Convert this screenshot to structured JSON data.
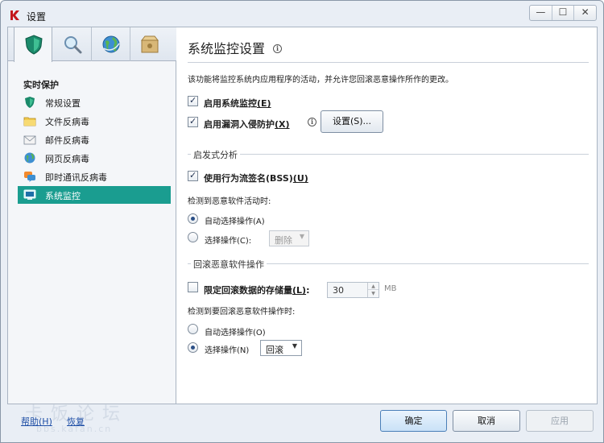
{
  "window": {
    "title": "设置",
    "accent_color": "#1a9d90"
  },
  "titlebar": {
    "minimize_glyph": "—",
    "maximize_glyph": "☐",
    "close_glyph": "✕"
  },
  "tabs": [
    {
      "name": "protection",
      "icon": "shield-icon",
      "active": true
    },
    {
      "name": "scan",
      "icon": "magnifier-icon",
      "active": false
    },
    {
      "name": "update",
      "icon": "globe-icon",
      "active": false
    },
    {
      "name": "options",
      "icon": "box-icon",
      "active": false
    }
  ],
  "sidebar": {
    "section_title": "实时保护",
    "items": [
      {
        "label": "常规设置",
        "icon": "shield-icon"
      },
      {
        "label": "文件反病毒",
        "icon": "folder-icon"
      },
      {
        "label": "邮件反病毒",
        "icon": "mail-icon"
      },
      {
        "label": "网页反病毒",
        "icon": "globe-icon"
      },
      {
        "label": "即时通讯反病毒",
        "icon": "chat-icon"
      },
      {
        "label": "系统监控",
        "icon": "monitor-icon",
        "selected": true
      }
    ]
  },
  "main": {
    "title": "系统监控设置",
    "description": "该功能将监控系统内应用程序的活动，并允许您回滚恶意操作所作的更改。",
    "enable_monitor": {
      "label": "启用系统监控",
      "shortcut": "(E)",
      "checked": true
    },
    "enable_exploit": {
      "label": "启用漏洞入侵防护",
      "shortcut": "(X)",
      "checked": true
    },
    "settings_button": "设置(S)...",
    "heuristic": {
      "group_title": "启发式分析",
      "bss": {
        "label": "使用行为流签名(BSS)",
        "shortcut": "(U)",
        "checked": true
      },
      "detect_label": "检测到恶意软件活动时:",
      "auto_option": "自动选择操作(A)",
      "select_option": "选择操作(C):",
      "action_value": "删除"
    },
    "rollback": {
      "group_title": "回滚恶意软件操作",
      "limit": {
        "label": "限定回滚数据的存储量",
        "shortcut": "(L)",
        "checked": false,
        "suffix": ":"
      },
      "limit_value": "30",
      "limit_unit": "MB",
      "detect_label": "检测到要回滚恶意软件操作时:",
      "auto_option": "自动选择操作(O)",
      "select_option": "选择操作(N)",
      "action_value": "回滚"
    }
  },
  "footer": {
    "help": "帮助(H)",
    "restore": "恢复",
    "ok": "确定",
    "cancel": "取消",
    "apply": "应用"
  },
  "watermark": {
    "line1": "卡饭论坛",
    "line2": "bbs.kafan.cn"
  }
}
